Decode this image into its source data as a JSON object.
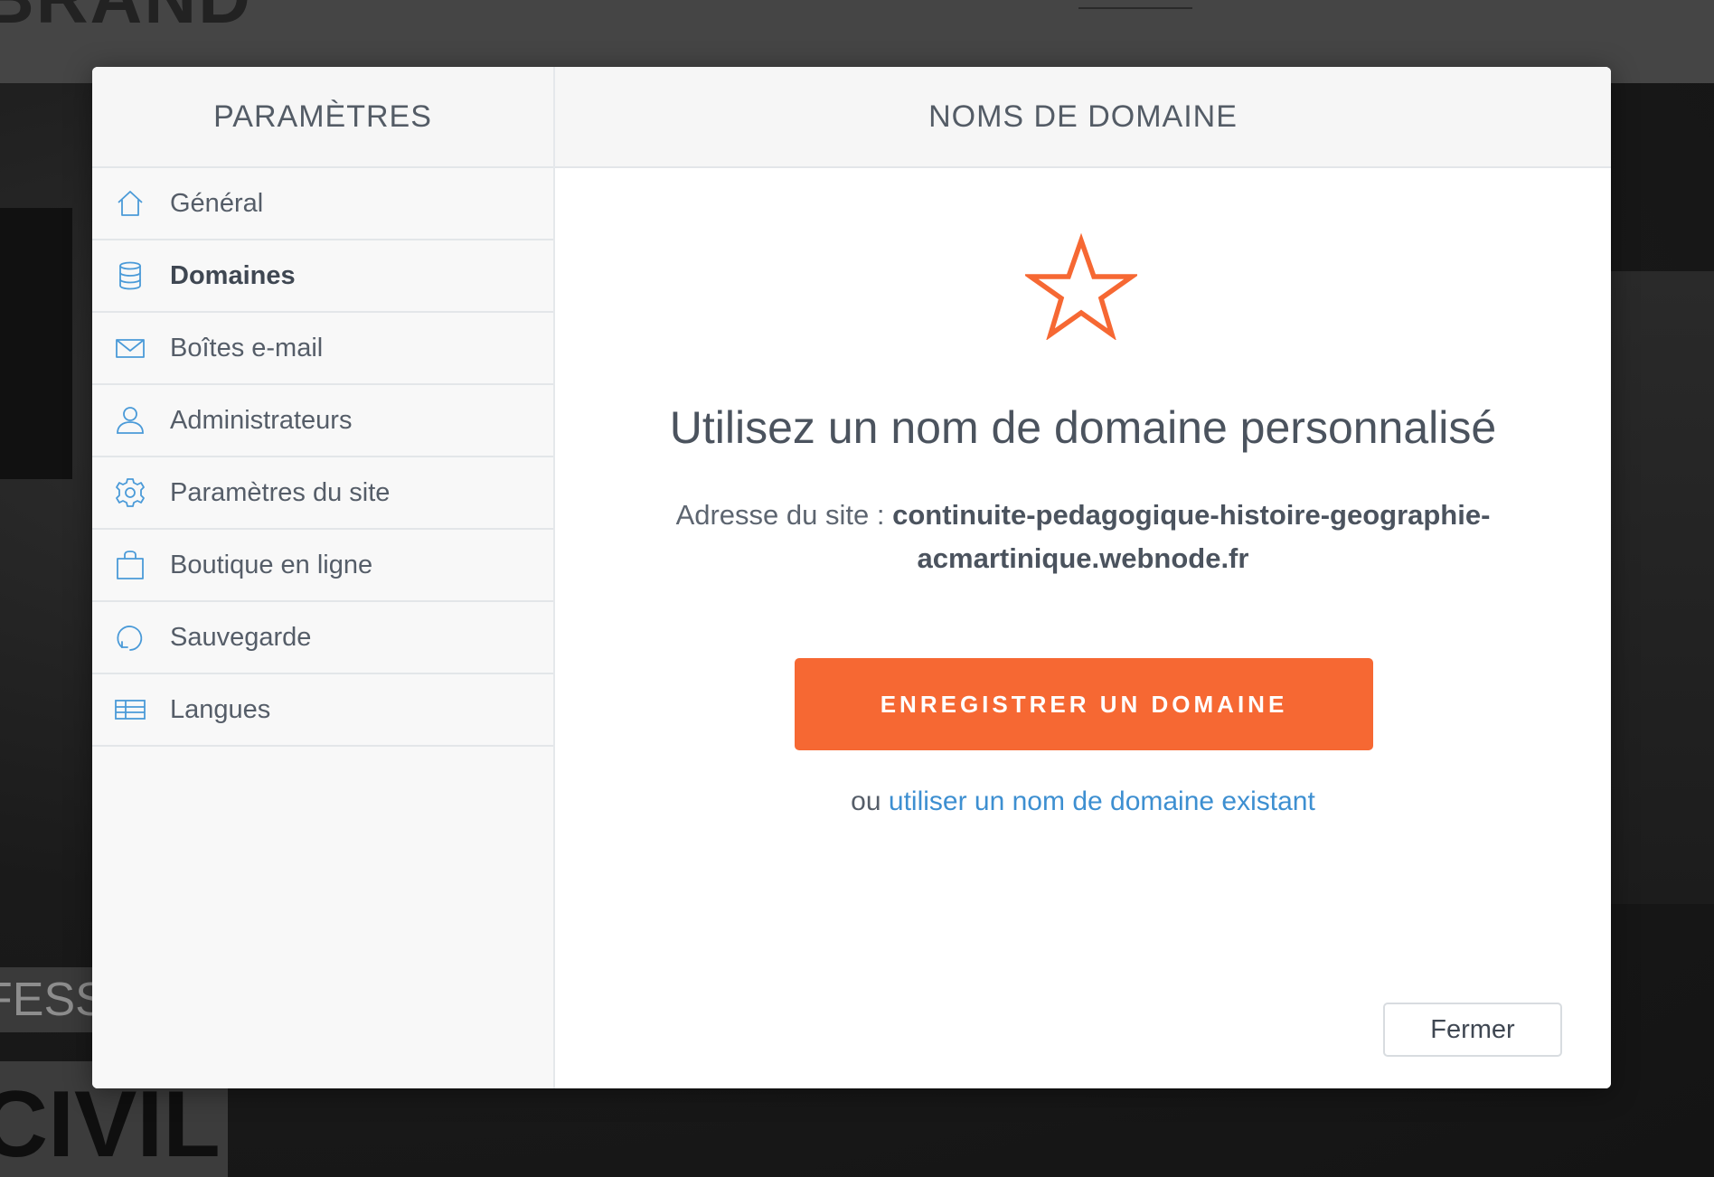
{
  "background": {
    "logo_text": "BRAND",
    "hero_text_1": "FESS",
    "hero_text_2": "CIVIL"
  },
  "sidebar": {
    "title": "PARAMÈTRES",
    "items": [
      {
        "label": "Général",
        "icon": "home-icon",
        "active": false
      },
      {
        "label": "Domaines",
        "icon": "database-icon",
        "active": true
      },
      {
        "label": "Boîtes e-mail",
        "icon": "envelope-icon",
        "active": false
      },
      {
        "label": "Administrateurs",
        "icon": "user-icon",
        "active": false
      },
      {
        "label": "Paramètres du site",
        "icon": "gear-icon",
        "active": false
      },
      {
        "label": "Boutique en ligne",
        "icon": "shopping-bag-icon",
        "active": false
      },
      {
        "label": "Sauvegarde",
        "icon": "refresh-icon",
        "active": false
      },
      {
        "label": "Langues",
        "icon": "languages-table-icon",
        "active": false
      }
    ]
  },
  "main": {
    "title": "NOMS DE DOMAINE",
    "icon": "star-icon",
    "heading": "Utilisez un nom de domaine personnalisé",
    "address_label": "Adresse du site :",
    "address_value_line1": "continuite-pedagogique-histoire-geographie-",
    "address_value_line2": "acmartinique.webnode.fr",
    "register_button": "ENREGISTRER UN DOMAINE",
    "alt_prefix": "ou",
    "alt_link": "utiliser un nom de domaine existant",
    "close_button": "Fermer"
  },
  "colors": {
    "accent": "#f66833",
    "link": "#3d8fd1",
    "icon_blue": "#4a9ad8",
    "text": "#555d68"
  }
}
